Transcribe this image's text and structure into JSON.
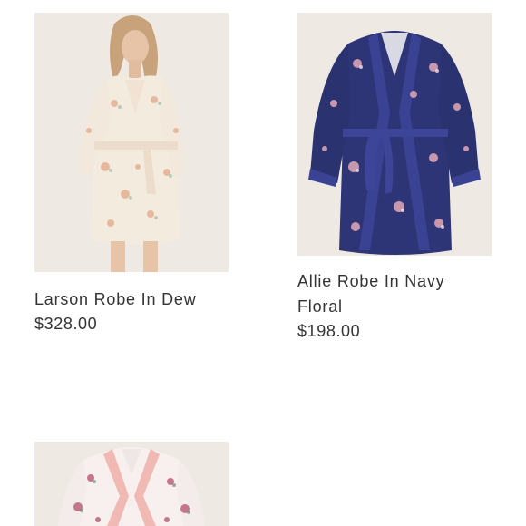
{
  "products": [
    {
      "title": "Larson Robe In Dew",
      "price": "$328.00",
      "image_colors": {
        "background": "#efe9e3",
        "robe": "#f4ebdf",
        "print": "#e2a98a",
        "skin": "#e7c4a8",
        "hair": "#c8a27a"
      }
    },
    {
      "title": "Allie Robe In Navy Floral",
      "price": "$198.00",
      "image_colors": {
        "background": "#efe9e3",
        "robe": "#2e3576",
        "trim": "#3a4294",
        "print": "#e2a9b8"
      }
    },
    {
      "title": "",
      "price": "",
      "image_colors": {
        "background": "#efe9e3",
        "robe": "#f7f0ef",
        "trim": "#f0b9b3",
        "print": "#b85a72"
      }
    }
  ]
}
